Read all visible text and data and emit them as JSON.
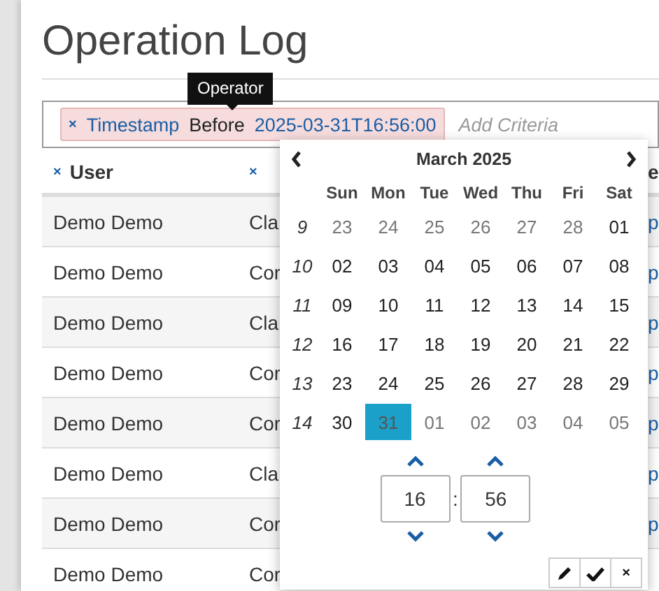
{
  "title": "Operation Log",
  "tooltip": "Operator",
  "filter": {
    "remove": "×",
    "field": "Timestamp",
    "operator": "Before",
    "value": "2025-03-31T16:56:00",
    "placeholder": "Add Criteria"
  },
  "columns": [
    {
      "remove": "×",
      "label": "User"
    },
    {
      "remove": "×"
    },
    {
      "label": "e"
    }
  ],
  "rows": [
    {
      "user": "Demo Demo",
      "column_2": "Cla",
      "column_3": "p"
    },
    {
      "user": "Demo Demo",
      "column_2": "Cor",
      "column_3": "p"
    },
    {
      "user": "Demo Demo",
      "column_2": "Cla",
      "column_3": "p"
    },
    {
      "user": "Demo Demo",
      "column_2": "Cor",
      "column_3": "p"
    },
    {
      "user": "Demo Demo",
      "column_2": "Cor",
      "column_3": "p"
    },
    {
      "user": "Demo Demo",
      "column_2": "Cla",
      "column_3": "p"
    },
    {
      "user": "Demo Demo",
      "column_2": "Cor",
      "column_3": "p"
    },
    {
      "user": "Demo Demo",
      "column_2": "Cor"
    }
  ],
  "calendar": {
    "month": "March 2025",
    "weekdays": [
      "Sun",
      "Mon",
      "Tue",
      "Wed",
      "Thu",
      "Fri",
      "Sat"
    ],
    "weeks": [
      {
        "week": "9",
        "days": [
          {
            "label": "23",
            "outside": true,
            "selected": false
          },
          {
            "label": "24",
            "outside": true,
            "selected": false
          },
          {
            "label": "25",
            "outside": true,
            "selected": false
          },
          {
            "label": "26",
            "outside": true,
            "selected": false
          },
          {
            "label": "27",
            "outside": true,
            "selected": false
          },
          {
            "label": "28",
            "outside": true,
            "selected": false
          },
          {
            "label": "01",
            "outside": false,
            "selected": false
          }
        ]
      },
      {
        "week": "10",
        "days": [
          {
            "label": "02",
            "outside": false,
            "selected": false
          },
          {
            "label": "03",
            "outside": false,
            "selected": false
          },
          {
            "label": "04",
            "outside": false,
            "selected": false
          },
          {
            "label": "05",
            "outside": false,
            "selected": false
          },
          {
            "label": "06",
            "outside": false,
            "selected": false
          },
          {
            "label": "07",
            "outside": false,
            "selected": false
          },
          {
            "label": "08",
            "outside": false,
            "selected": false
          }
        ]
      },
      {
        "week": "11",
        "days": [
          {
            "label": "09",
            "outside": false,
            "selected": false
          },
          {
            "label": "10",
            "outside": false,
            "selected": false
          },
          {
            "label": "11",
            "outside": false,
            "selected": false
          },
          {
            "label": "12",
            "outside": false,
            "selected": false
          },
          {
            "label": "13",
            "outside": false,
            "selected": false
          },
          {
            "label": "14",
            "outside": false,
            "selected": false
          },
          {
            "label": "15",
            "outside": false,
            "selected": false
          }
        ]
      },
      {
        "week": "12",
        "days": [
          {
            "label": "16",
            "outside": false,
            "selected": false
          },
          {
            "label": "17",
            "outside": false,
            "selected": false
          },
          {
            "label": "18",
            "outside": false,
            "selected": false
          },
          {
            "label": "19",
            "outside": false,
            "selected": false
          },
          {
            "label": "20",
            "outside": false,
            "selected": false
          },
          {
            "label": "21",
            "outside": false,
            "selected": false
          },
          {
            "label": "22",
            "outside": false,
            "selected": false
          }
        ]
      },
      {
        "week": "13",
        "days": [
          {
            "label": "23",
            "outside": false,
            "selected": false
          },
          {
            "label": "24",
            "outside": false,
            "selected": false
          },
          {
            "label": "25",
            "outside": false,
            "selected": false
          },
          {
            "label": "26",
            "outside": false,
            "selected": false
          },
          {
            "label": "27",
            "outside": false,
            "selected": false
          },
          {
            "label": "28",
            "outside": false,
            "selected": false
          },
          {
            "label": "29",
            "outside": false,
            "selected": false
          }
        ]
      },
      {
        "week": "14",
        "days": [
          {
            "label": "30",
            "outside": false,
            "selected": false
          },
          {
            "label": "31",
            "outside": false,
            "selected": true
          },
          {
            "label": "01",
            "outside": true,
            "selected": false
          },
          {
            "label": "02",
            "outside": true,
            "selected": false
          },
          {
            "label": "03",
            "outside": true,
            "selected": false
          },
          {
            "label": "04",
            "outside": true,
            "selected": false
          },
          {
            "label": "05",
            "outside": true,
            "selected": false
          }
        ]
      }
    ],
    "hour": "16",
    "separator": ":",
    "minute": "56"
  },
  "actions": [
    {
      "kind": "edit"
    },
    {
      "kind": "confirm"
    },
    {
      "kind": "close",
      "text": "×"
    }
  ]
}
